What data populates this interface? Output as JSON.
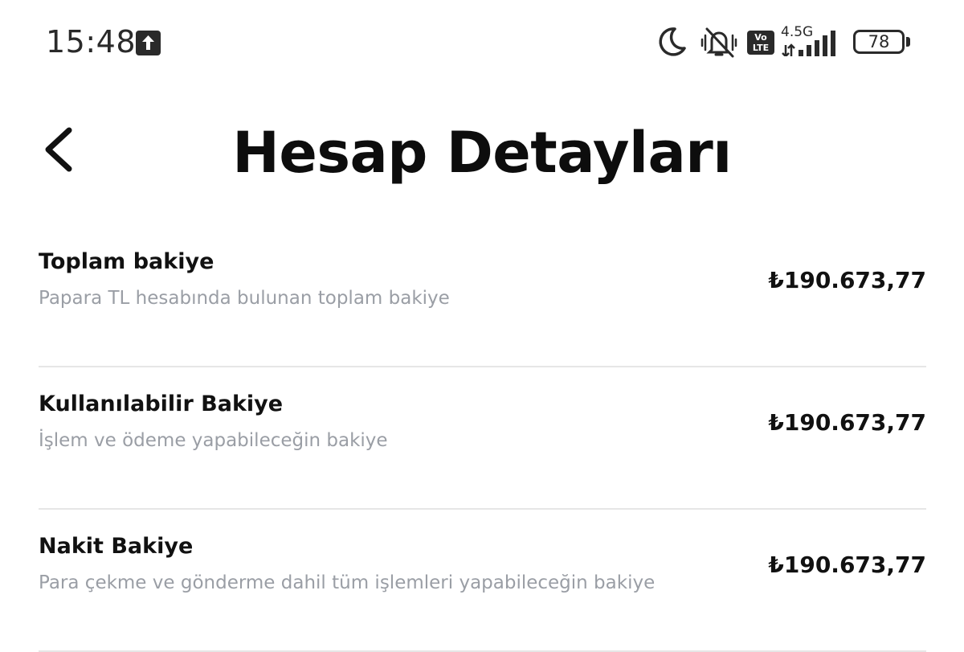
{
  "status_bar": {
    "time": "15:48",
    "network_type": "4.5G",
    "volte_label_top": "Vo",
    "volte_label_bottom": "LTE",
    "battery_level": "78",
    "icons": [
      "upload-arrow-icon",
      "moon-icon",
      "mute-icon",
      "volte-icon",
      "signal-icon",
      "battery-icon"
    ]
  },
  "header": {
    "title": "Hesap Detayları",
    "back_icon": "chevron-left-icon"
  },
  "balances": [
    {
      "title": "Toplam bakiye",
      "description": "Papara TL hesabında bulunan toplam bakiye",
      "amount": "₺190.673,77"
    },
    {
      "title": "Kullanılabilir Bakiye",
      "description": "İşlem ve ödeme yapabileceğin bakiye",
      "amount": "₺190.673,77"
    },
    {
      "title": "Nakit Bakiye",
      "description": "Para çekme ve gönderme dahil tüm işlemleri yapabileceğin bakiye",
      "amount": "₺190.673,77"
    }
  ]
}
